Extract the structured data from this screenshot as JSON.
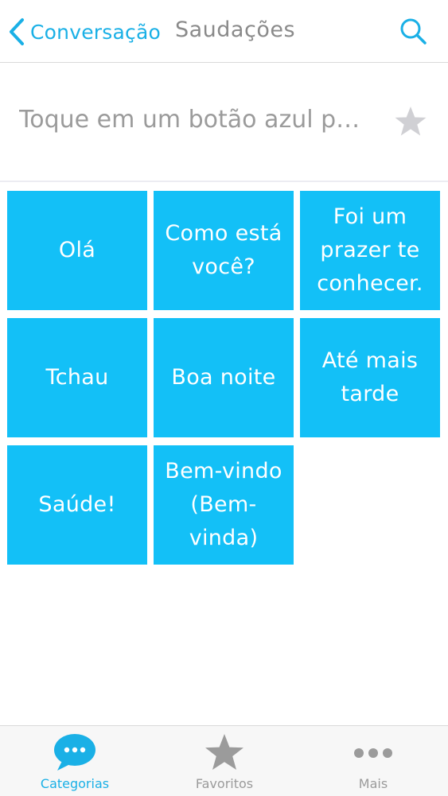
{
  "navbar": {
    "back_label": "Conversação",
    "title": "Saudações"
  },
  "prompt": {
    "text": "Toque em um botão azul p…"
  },
  "phrases": [
    "Olá",
    "Como está você?",
    "Foi um prazer te conhecer.",
    "Tchau",
    "Boa noite",
    "Até mais tarde",
    "Saúde!",
    "Bem-vindo (Bem-vinda)"
  ],
  "tabs": [
    {
      "label": "Categorias",
      "icon": "chat-bubble-icon",
      "active": true
    },
    {
      "label": "Favoritos",
      "icon": "star-icon",
      "active": false
    },
    {
      "label": "Mais",
      "icon": "more-dots-icon",
      "active": false
    }
  ],
  "colors": {
    "accent": "#1ab0e6",
    "tile": "#13c0f7",
    "muted": "#9b9b9b"
  }
}
